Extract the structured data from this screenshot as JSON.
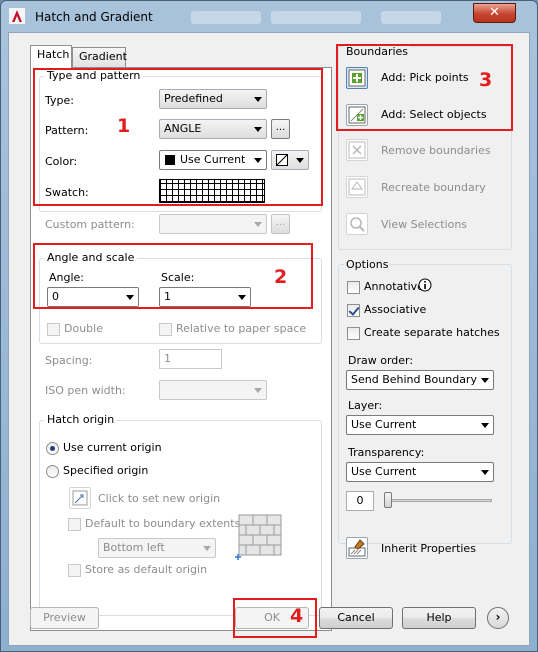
{
  "window": {
    "title": "Hatch and Gradient",
    "close_label": "✕"
  },
  "tabs": [
    {
      "label": "Hatch"
    },
    {
      "label": "Gradient"
    }
  ],
  "hatch": {
    "type_pattern": {
      "group_label": "Type and pattern",
      "type_label": "Type:",
      "type_value": "Predefined",
      "pattern_label": "Pattern:",
      "pattern_value": "ANGLE",
      "pattern_browse": "...",
      "color_label": "Color:",
      "color_value": "Use Current",
      "swatch_label": "Swatch:",
      "custom_pattern_label": "Custom pattern:",
      "custom_browse": "..."
    },
    "angle_scale": {
      "group_label": "Angle and scale",
      "angle_label": "Angle:",
      "angle_value": "0",
      "scale_label": "Scale:",
      "scale_value": "1",
      "double_label": "Double",
      "relative_label": "Relative to paper space",
      "spacing_label": "Spacing:",
      "spacing_value": "1",
      "iso_label": "ISO pen width:"
    },
    "origin": {
      "group_label": "Hatch origin",
      "use_current_label": "Use current origin",
      "specified_label": "Specified origin",
      "click_label": "Click to set new origin",
      "default_extents_label": "Default to boundary extents",
      "bottom_left": "Bottom left",
      "store_label": "Store as default origin"
    }
  },
  "boundaries": {
    "group_label": "Boundaries",
    "pick_points": "Add: Pick points",
    "select_objects": "Add: Select objects",
    "remove": "Remove boundaries",
    "recreate": "Recreate boundary",
    "view": "View Selections"
  },
  "options": {
    "group_label": "Options",
    "annotative_label": "Annotative",
    "associative_label": "Associative",
    "separate_label": "Create separate hatches",
    "draw_order_label": "Draw order:",
    "draw_order_value": "Send Behind Boundary",
    "layer_label": "Layer:",
    "layer_value": "Use Current",
    "transparency_label": "Transparency:",
    "transparency_value": "Use Current",
    "transparency_amount": "0"
  },
  "inherit_label": "Inherit Properties",
  "footer": {
    "preview": "Preview",
    "ok": "OK",
    "cancel": "Cancel",
    "help": "Help"
  },
  "annotations": {
    "n1": "1",
    "n2": "2",
    "n3": "3",
    "n4": "4"
  },
  "colors": {
    "annotation_red": "#e11d1d",
    "close_red": "#c74530"
  }
}
